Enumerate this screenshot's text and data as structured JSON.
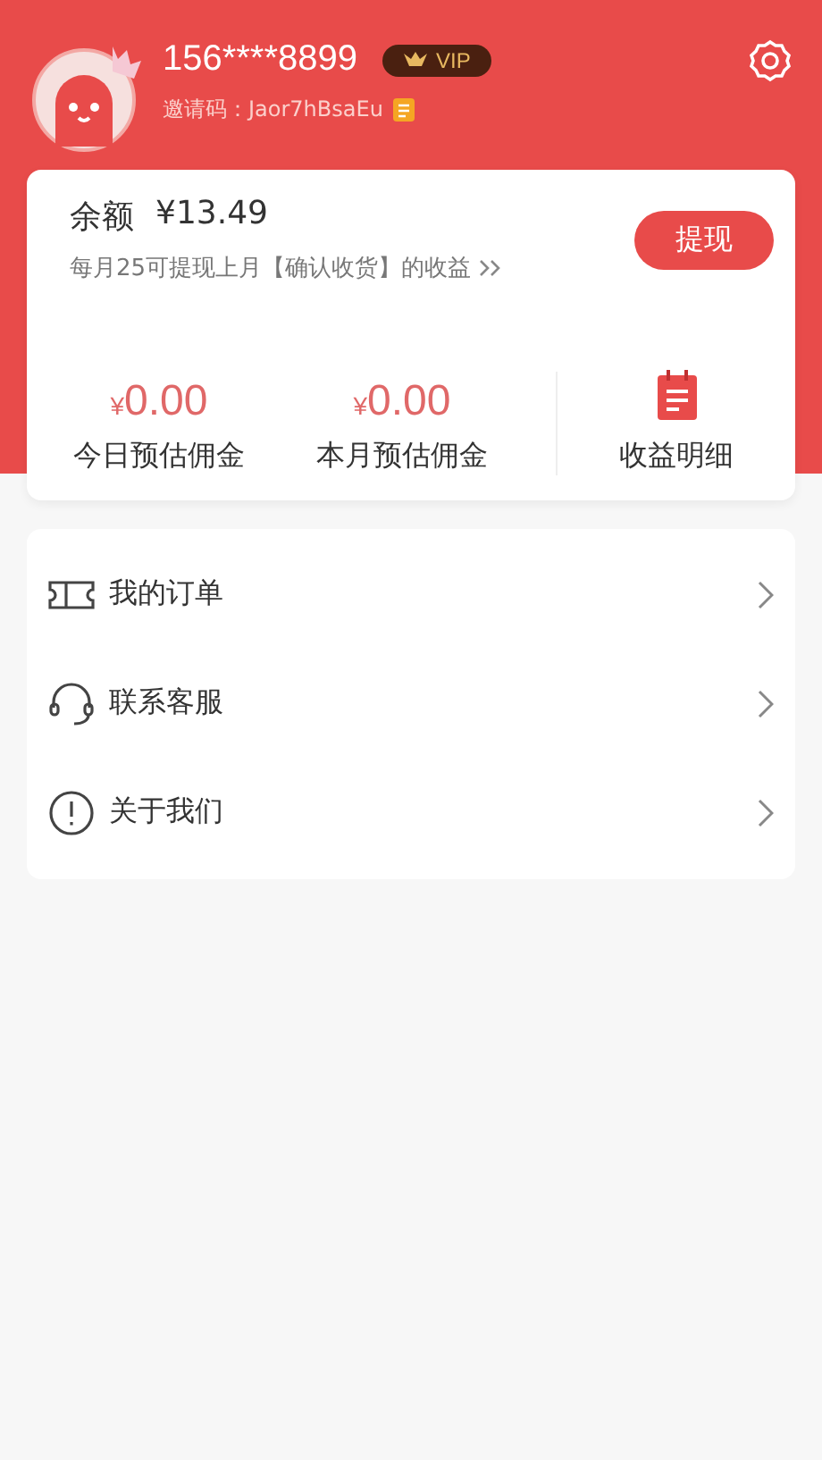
{
  "profile": {
    "phone": "156****8899",
    "badge": "VIP",
    "invite_label": "邀请码：",
    "invite_code": "Jaor7hBsaEu"
  },
  "balance": {
    "label": "余额",
    "amount": "¥13.49",
    "note": "每月25可提现上月【确认收货】的收益",
    "button": "提现"
  },
  "stats": [
    {
      "currency": "¥",
      "value": "0.00",
      "label": "今日预估佣金"
    },
    {
      "currency": "¥",
      "value": "0.00",
      "label": "本月预估佣金"
    }
  ],
  "detail": {
    "label": "收益明细"
  },
  "menu": [
    {
      "kind": "ticket",
      "label": "我的订单"
    },
    {
      "kind": "headset",
      "label": "联系客服"
    },
    {
      "kind": "info",
      "label": "关于我们"
    }
  ]
}
